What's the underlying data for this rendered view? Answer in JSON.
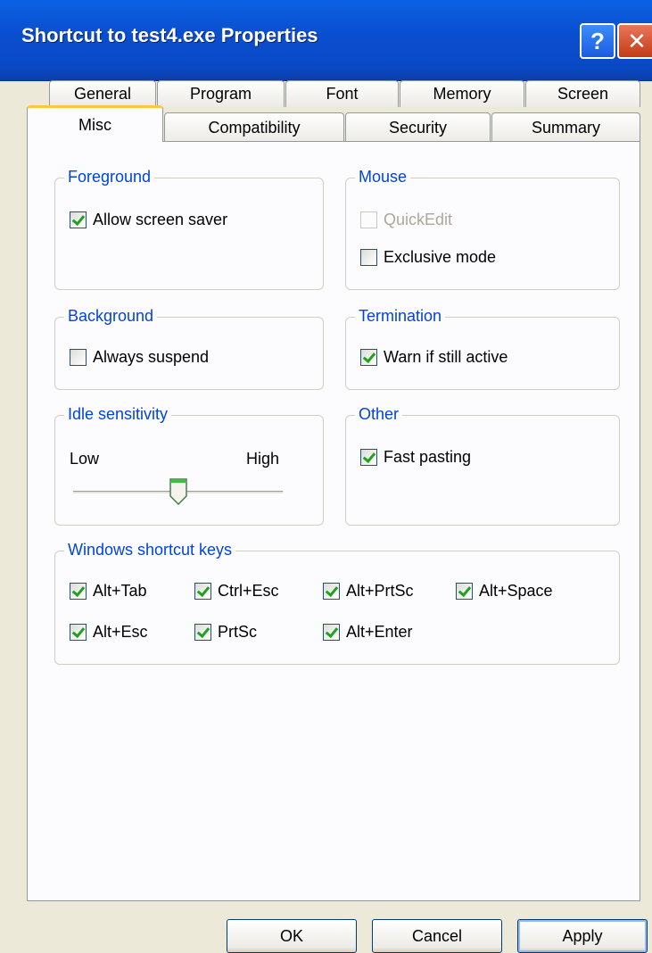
{
  "window": {
    "title": "Shortcut to test4.exe Properties",
    "help_glyph": "?",
    "close_glyph": "✕"
  },
  "tabs": {
    "row_back": [
      "General",
      "Program",
      "Font",
      "Memory",
      "Screen"
    ],
    "row_front": [
      "Misc",
      "Compatibility",
      "Security",
      "Summary"
    ],
    "active": "Misc"
  },
  "foreground": {
    "title": "Foreground",
    "allow_screen_saver": {
      "label": "Allow screen saver",
      "checked": true
    }
  },
  "mouse": {
    "title": "Mouse",
    "quickedit": {
      "label": "QuickEdit",
      "checked": false,
      "enabled": false
    },
    "exclusive_mode": {
      "label": "Exclusive mode",
      "checked": false
    }
  },
  "background": {
    "title": "Background",
    "always_suspend": {
      "label": "Always suspend",
      "checked": false
    }
  },
  "termination": {
    "title": "Termination",
    "warn_if_active": {
      "label": "Warn if still active",
      "checked": true
    }
  },
  "idle": {
    "title": "Idle sensitivity",
    "low_label": "Low",
    "high_label": "High",
    "level_fraction": 0.5
  },
  "other": {
    "title": "Other",
    "fast_pasting": {
      "label": "Fast pasting",
      "checked": true
    }
  },
  "shortcut_keys": {
    "title": "Windows shortcut keys",
    "alt_tab": {
      "label": "Alt+Tab",
      "checked": true
    },
    "ctrl_esc": {
      "label": "Ctrl+Esc",
      "checked": true
    },
    "alt_prtsc": {
      "label": "Alt+PrtSc",
      "checked": true
    },
    "alt_space": {
      "label": "Alt+Space",
      "checked": true
    },
    "alt_esc": {
      "label": "Alt+Esc",
      "checked": true
    },
    "prtsc": {
      "label": "PrtSc",
      "checked": true
    },
    "alt_enter": {
      "label": "Alt+Enter",
      "checked": true
    }
  },
  "buttons": {
    "ok": "OK",
    "cancel": "Cancel",
    "apply": "Apply"
  },
  "colors": {
    "titlebar": "#0a4fd1",
    "group_title": "#0046d5",
    "active_tab_accent": "#ffc83c",
    "check_mark": "#21a121"
  }
}
